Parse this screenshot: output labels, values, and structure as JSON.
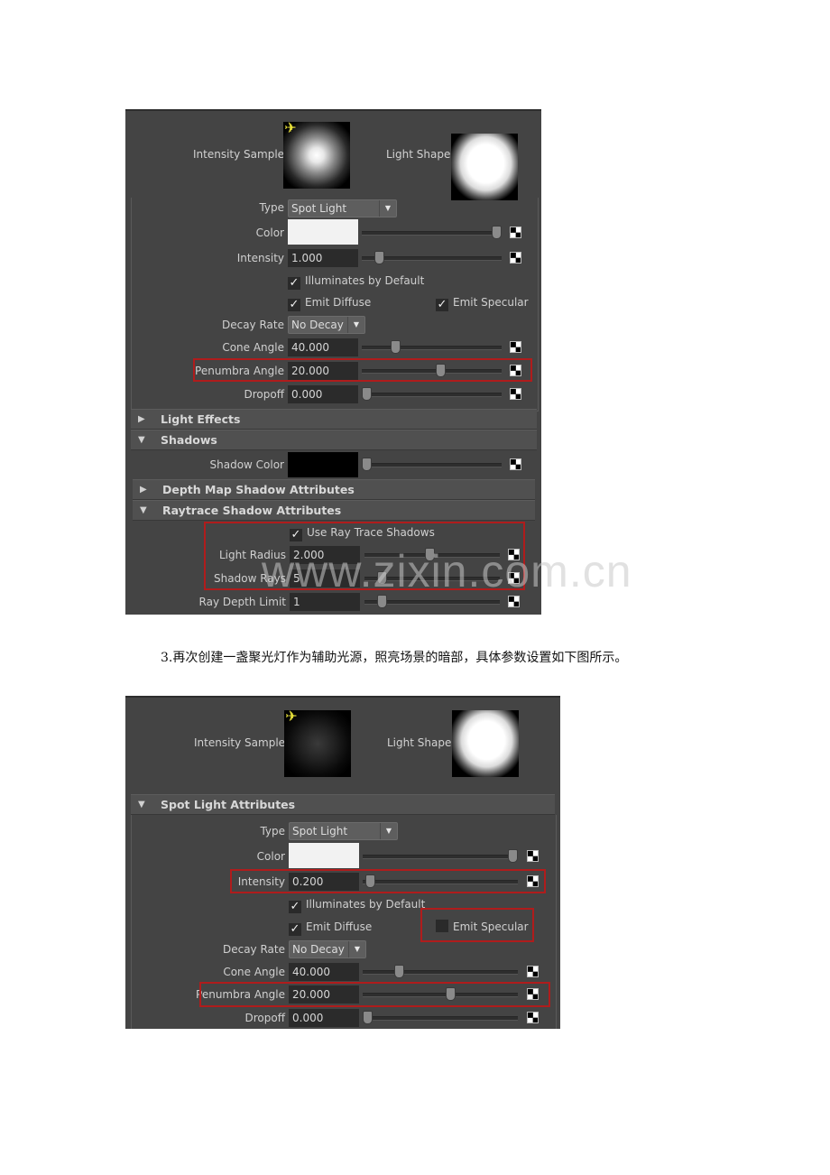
{
  "panel1": {
    "swatches": {
      "intensity_label": "Intensity Sample",
      "shape_label": "Light Shape"
    },
    "type": {
      "label": "Type",
      "value": "Spot Light"
    },
    "color": {
      "label": "Color",
      "value": "#f2f2f2",
      "slider": 1.0
    },
    "intensity": {
      "label": "Intensity",
      "value": "1.000",
      "slider": 0.1
    },
    "illuminates_by_default": {
      "label": "Illuminates by Default",
      "checked": true
    },
    "emit_diffuse": {
      "label": "Emit Diffuse",
      "checked": true
    },
    "emit_specular": {
      "label": "Emit Specular",
      "checked": true
    },
    "decay_rate": {
      "label": "Decay Rate",
      "value": "No Decay"
    },
    "cone_angle": {
      "label": "Cone Angle",
      "value": "40.000",
      "slider": 0.22
    },
    "penumbra_angle": {
      "label": "Penumbra Angle",
      "value": "20.000",
      "slider": 0.57
    },
    "dropoff": {
      "label": "Dropoff",
      "value": "0.000",
      "slider": 0.0
    },
    "sections": {
      "light_effects": "Light Effects",
      "shadows": "Shadows",
      "depth_map": "Depth Map Shadow Attributes",
      "raytrace": "Raytrace Shadow Attributes"
    },
    "shadow_color": {
      "label": "Shadow Color",
      "value": "#000000",
      "slider": 0.0
    },
    "use_ray_trace": {
      "label": "Use Ray Trace Shadows",
      "checked": true
    },
    "light_radius": {
      "label": "Light Radius",
      "value": "2.000",
      "slider": 0.48
    },
    "shadow_rays": {
      "label": "Shadow Rays",
      "value": "5",
      "slider": 0.1
    },
    "ray_depth_limit": {
      "label": "Ray Depth Limit",
      "value": "1",
      "slider": 0.1
    }
  },
  "caption": "3.再次创建一盏聚光灯作为辅助光源，照亮场景的暗部，具体参数设置如下图所示。",
  "watermark": "www.zixin.com.cn",
  "panel2": {
    "swatches": {
      "intensity_label": "Intensity Sample",
      "shape_label": "Light Shape"
    },
    "section": "Spot Light Attributes",
    "type": {
      "label": "Type",
      "value": "Spot Light"
    },
    "color": {
      "label": "Color",
      "value": "#f2f2f2",
      "slider": 1.0
    },
    "intensity": {
      "label": "Intensity",
      "value": "0.200",
      "slider": 0.02
    },
    "illuminates_by_default": {
      "label": "Illuminates by Default",
      "checked": true
    },
    "emit_diffuse": {
      "label": "Emit Diffuse",
      "checked": true
    },
    "emit_specular": {
      "label": "Emit Specular",
      "checked": false
    },
    "decay_rate": {
      "label": "Decay Rate",
      "value": "No Decay"
    },
    "cone_angle": {
      "label": "Cone Angle",
      "value": "40.000",
      "slider": 0.22
    },
    "penumbra_angle": {
      "label": "Penumbra Angle",
      "value": "20.000",
      "slider": 0.57
    },
    "dropoff": {
      "label": "Dropoff",
      "value": "0.000",
      "slider": 0.0
    }
  },
  "colors": {
    "highlight": "#b01c1c",
    "panel_bg": "#444444",
    "icon_yellow": "#e9e23a"
  }
}
